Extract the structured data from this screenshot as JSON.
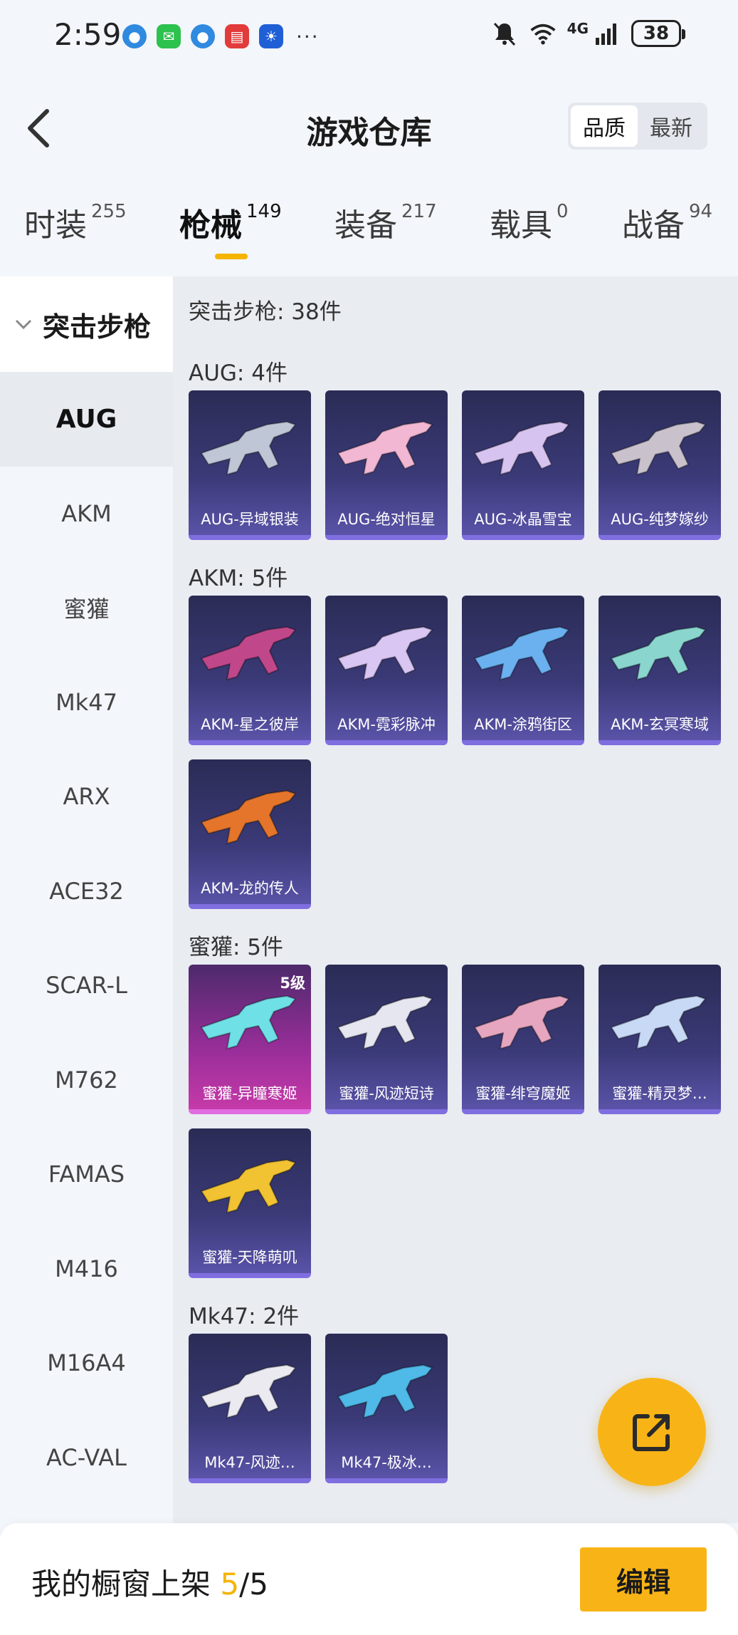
{
  "status_bar": {
    "time": "2:59",
    "battery": "38",
    "signal_text": "4G"
  },
  "header": {
    "title": "游戏仓库",
    "sort_options": [
      "品质",
      "最新"
    ],
    "sort_active": "品质"
  },
  "tabs": [
    {
      "label": "时装",
      "count": "255"
    },
    {
      "label": "枪械",
      "count": "149",
      "active": true
    },
    {
      "label": "装备",
      "count": "217"
    },
    {
      "label": "载具",
      "count": "0"
    },
    {
      "label": "战备",
      "count": "94"
    }
  ],
  "sidebar": {
    "group_label": "突击步枪",
    "items": [
      "AUG",
      "AKM",
      "蜜獾",
      "Mk47",
      "ARX",
      "ACE32",
      "SCAR-L",
      "M762",
      "FAMAS",
      "M416",
      "M16A4",
      "AC-VAL"
    ],
    "active": "AUG"
  },
  "content": {
    "total": "突击步枪: 38件",
    "groups": [
      {
        "head": "AUG: 4件",
        "items": [
          {
            "name": "AUG-异域银装",
            "color": "#bfc6d6"
          },
          {
            "name": "AUG-绝对恒星",
            "color": "#f2b7d2"
          },
          {
            "name": "AUG-冰晶雪宝",
            "color": "#d7c3f0"
          },
          {
            "name": "AUG-纯梦嫁纱",
            "color": "#c9c2cc"
          }
        ]
      },
      {
        "head": "AKM: 5件",
        "items": [
          {
            "name": "AKM-星之彼岸",
            "color": "#c0488a"
          },
          {
            "name": "AKM-霓彩脉冲",
            "color": "#d9c6f2"
          },
          {
            "name": "AKM-涂鸦街区",
            "color": "#6bb1f0"
          },
          {
            "name": "AKM-玄冥寒域",
            "color": "#8ad6cf"
          },
          {
            "name": "AKM-龙的传人",
            "color": "#e4752a"
          }
        ]
      },
      {
        "head": "蜜獾: 5件",
        "items": [
          {
            "name": "蜜獾-异瞳寒姬",
            "color": "#6fe0e6",
            "level": "5级",
            "rare": true
          },
          {
            "name": "蜜獾-风迹短诗",
            "color": "#e6e6f0"
          },
          {
            "name": "蜜獾-绯穹魔姬",
            "color": "#e7a6bf"
          },
          {
            "name": "蜜獾-精灵梦…",
            "color": "#c7d9f5"
          },
          {
            "name": "蜜獾-天降萌叽",
            "color": "#f1c232"
          }
        ]
      },
      {
        "head": "Mk47: 2件",
        "items": [
          {
            "name": "Mk47-风迹…",
            "color": "#eaeaf0"
          },
          {
            "name": "Mk47-极冰…",
            "color": "#4fb9e8"
          }
        ]
      }
    ]
  },
  "bottom_bar": {
    "label_prefix": "我的橱窗上架 ",
    "current": "5",
    "sep_total": "/5",
    "edit_label": "编辑"
  }
}
